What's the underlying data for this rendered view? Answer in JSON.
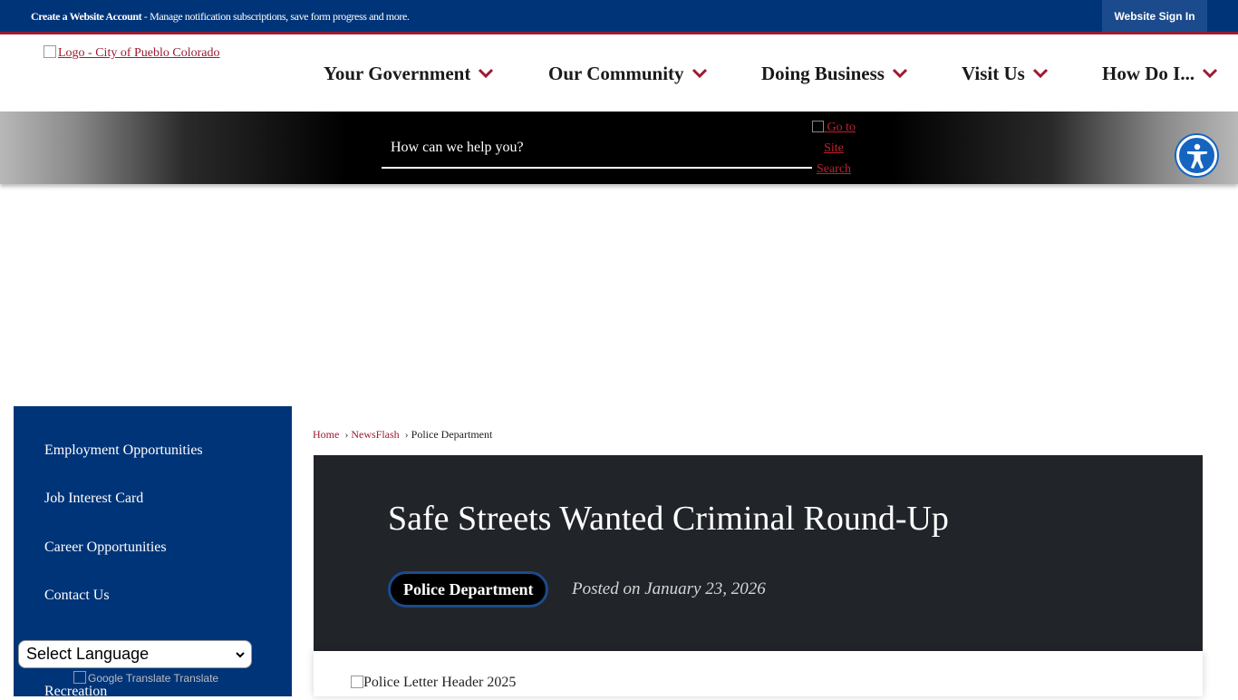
{
  "topbar": {
    "message_bold": "Create a Website Account",
    "message_rest": " - Manage notification subscriptions, save form progress and more.",
    "signin_label": "Website Sign In"
  },
  "header": {
    "logo_alt": "Logo - City of Pueblo Colorado",
    "nav": [
      {
        "label": "Your Government"
      },
      {
        "label": "Our Community"
      },
      {
        "label": "Doing Business"
      },
      {
        "label": "Visit Us"
      },
      {
        "label": "How Do I..."
      }
    ]
  },
  "search": {
    "placeholder": "How can we help you?",
    "go_label": "Go to Site Search"
  },
  "sidebar": {
    "items": [
      {
        "label": "Employment Opportunities"
      },
      {
        "label": "Job Interest Card"
      },
      {
        "label": "Career Opportunities"
      },
      {
        "label": "Contact Us"
      },
      {
        "label": "Recreation"
      }
    ]
  },
  "translate": {
    "select_label": "Select Language",
    "powered_alt": "Google Translate",
    "powered_text": "Translate"
  },
  "breadcrumb": {
    "items": [
      "Home",
      "NewsFlash",
      "Police Department"
    ]
  },
  "article": {
    "title": "Safe Streets Wanted Criminal Round-Up",
    "department": "Police Department",
    "posted": "Posted on January 23, 2026",
    "image_alt": "Police Letter Header 2025"
  },
  "colors": {
    "brand_blue": "#003478",
    "accent_red": "#9b1b30",
    "article_dark": "#212429"
  }
}
